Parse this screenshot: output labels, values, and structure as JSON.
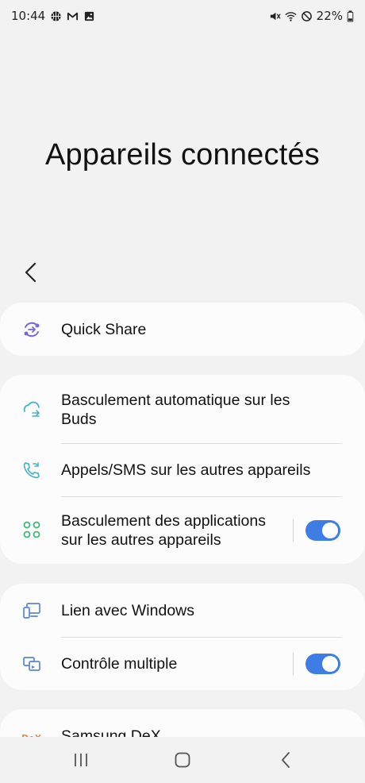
{
  "status_bar": {
    "time": "10:44",
    "battery": "22%",
    "left_icons": [
      "basketball-icon",
      "gmail-icon",
      "gallery-icon"
    ],
    "right_icons": [
      "mute-icon",
      "wifi-icon",
      "do-not-disturb-icon",
      "battery-icon"
    ]
  },
  "header": {
    "title": "Appareils connectés",
    "back_icon": "chevron-left-icon"
  },
  "colors": {
    "toggle_on": "#3e7ee4",
    "quick_share_icon": "#7b68d8",
    "connect_icon": "#4fb2c2",
    "green_icon": "#3fb77b",
    "windows_icon": "#5a86d6",
    "dex_icon": "#ef8a4a"
  },
  "groups": [
    {
      "items": [
        {
          "label": "Quick Share",
          "icon": "quick-share-icon"
        }
      ]
    },
    {
      "items": [
        {
          "label_line1": "Basculement automatique sur les",
          "label_line2": "Buds",
          "icon": "auto-switch-buds-icon"
        },
        {
          "label": "Appels/SMS sur les autres appareils",
          "icon": "calls-sms-icon"
        },
        {
          "label_line1": "Basculement des applications",
          "label_line2": "sur les autres appareils",
          "icon": "app-continuity-icon",
          "toggle": "on"
        }
      ]
    },
    {
      "items": [
        {
          "label": "Lien avec Windows",
          "icon": "link-windows-icon"
        },
        {
          "label": "Contrôle multiple",
          "icon": "multi-control-icon",
          "toggle": "on"
        }
      ]
    },
    {
      "items": [
        {
          "label": "Samsung DeX",
          "icon": "dex-icon"
        }
      ]
    }
  ],
  "nav_bar": {
    "buttons": [
      "recents-icon",
      "home-icon",
      "back-icon"
    ]
  }
}
